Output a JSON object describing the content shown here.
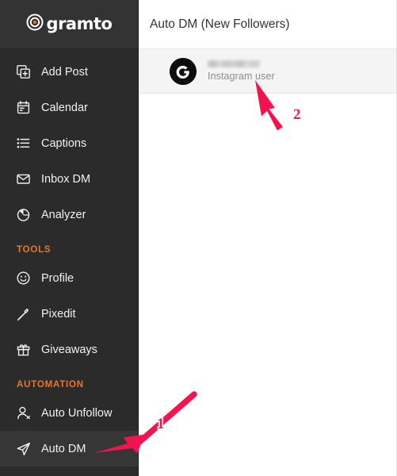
{
  "brand": {
    "name": "gramto",
    "logo_icon": "bullseye-target-icon",
    "accent_color": "#e8762a"
  },
  "sidebar": {
    "background_color": "#2b2b2b",
    "items": [
      {
        "label": "Add Post",
        "icon": "add-post-icon",
        "type": "item",
        "active": false
      },
      {
        "label": "Calendar",
        "icon": "calendar-icon",
        "type": "item",
        "active": false
      },
      {
        "label": "Captions",
        "icon": "list-icon",
        "type": "item",
        "active": false
      },
      {
        "label": "Inbox DM",
        "icon": "envelope-icon",
        "type": "item",
        "active": false
      },
      {
        "label": "Analyzer",
        "icon": "pie-chart-icon",
        "type": "item",
        "active": false
      },
      {
        "label": "TOOLS",
        "icon": "",
        "type": "section",
        "active": false
      },
      {
        "label": "Profile",
        "icon": "smiley-face-icon",
        "type": "item",
        "active": false
      },
      {
        "label": "Pixedit",
        "icon": "magic-wand-icon",
        "type": "item",
        "active": false
      },
      {
        "label": "Giveaways",
        "icon": "gift-icon",
        "type": "item",
        "active": false
      },
      {
        "label": "AUTOMATION",
        "icon": "",
        "type": "section",
        "active": false
      },
      {
        "label": "Auto Unfollow",
        "icon": "user-remove-icon",
        "type": "item",
        "active": false
      },
      {
        "label": "Auto DM",
        "icon": "paper-plane-icon",
        "type": "item",
        "active": true
      }
    ]
  },
  "header": {
    "title": "Auto DM (New Followers)"
  },
  "main": {
    "user_list": [
      {
        "avatar_icon": "instagram-avatar-icon",
        "username": "",
        "username_redacted": true,
        "subtitle": "Instagram user"
      }
    ]
  },
  "annotations": {
    "color": "#f4124f",
    "markers": [
      {
        "label": "1",
        "points_to": "sidebar-item-auto-dm"
      },
      {
        "label": "2",
        "points_to": "user-list-item"
      }
    ]
  }
}
